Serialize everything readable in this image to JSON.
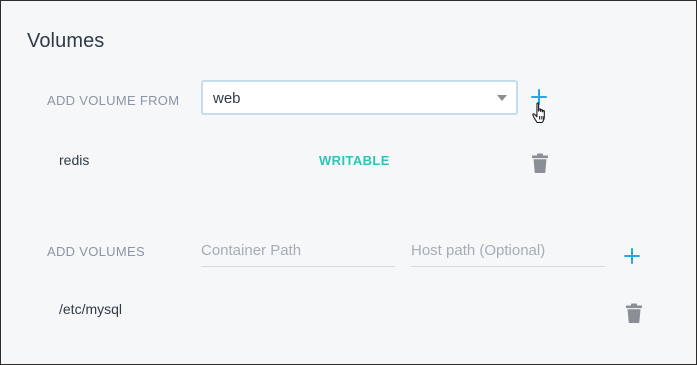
{
  "section": {
    "title": "Volumes"
  },
  "volumes_from": {
    "label": "ADD VOLUME FROM",
    "selected": "web",
    "entries": [
      {
        "name": "redis",
        "mode": "WRITABLE"
      }
    ]
  },
  "volumes": {
    "label": "ADD VOLUMES",
    "container_path_placeholder": "Container Path",
    "host_path_placeholder": "Host path (Optional)",
    "entries": [
      {
        "path": "/etc/mysql"
      }
    ]
  },
  "colors": {
    "accent": "#26a7e1",
    "writable": "#2ec4b6",
    "label": "#8a96a3",
    "text": "#2f3b47",
    "icon": "#8a8f96"
  },
  "icons": {
    "add": "plus-icon",
    "delete": "trash-icon",
    "cursor": "hand-pointer-cursor-icon",
    "dropdown": "chevron-down-icon"
  }
}
